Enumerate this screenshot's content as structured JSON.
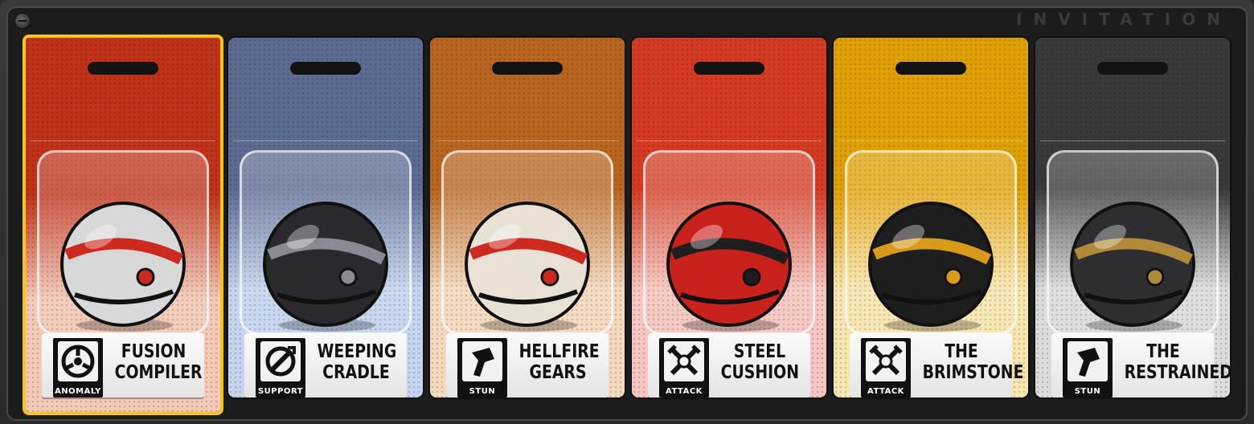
{
  "header": {
    "title": "INVITATION"
  },
  "cards": [
    {
      "line1": "FUSION",
      "line2": "COMPILER",
      "role": "ANOMALY",
      "role_icon": "anomaly-icon",
      "color_top": "#c0331a",
      "color_bottom": "#f4c9b8",
      "orb": "#d8d8d8",
      "accent": "#cc2a1e",
      "selected": true
    },
    {
      "line1": "WEEPING",
      "line2": "CRADLE",
      "role": "SUPPORT",
      "role_icon": "support-icon",
      "color_top": "#5c6b92",
      "color_bottom": "#c5d5ee",
      "orb": "#2a2a2e",
      "accent": "#8a8a94",
      "selected": false
    },
    {
      "line1": "HELLFIRE",
      "line2": "GEARS",
      "role": "STUN",
      "role_icon": "stun-icon",
      "color_top": "#b8651f",
      "color_bottom": "#f4d9bf",
      "orb": "#e8e2d6",
      "accent": "#cc2a1e",
      "selected": false
    },
    {
      "line1": "STEEL",
      "line2": "CUSHION",
      "role": "ATTACK",
      "role_icon": "attack-icon",
      "color_top": "#d43b22",
      "color_bottom": "#f6c6c0",
      "orb": "#c9221c",
      "accent": "#1e1e1e",
      "selected": false
    },
    {
      "line1": "THE",
      "line2": "BRIMSTONE",
      "role": "ATTACK",
      "role_icon": "attack-icon",
      "color_top": "#e0a000",
      "color_bottom": "#f8e6b0",
      "orb": "#1e1e1e",
      "accent": "#d89a1a",
      "selected": false
    },
    {
      "line1": "THE",
      "line2": "RESTRAINED",
      "role": "STUN",
      "role_icon": "stun-icon",
      "color_top": "#3a3a3a",
      "color_bottom": "#dcdcdc",
      "orb": "#2e2e30",
      "accent": "#b08a3a",
      "selected": false
    }
  ]
}
